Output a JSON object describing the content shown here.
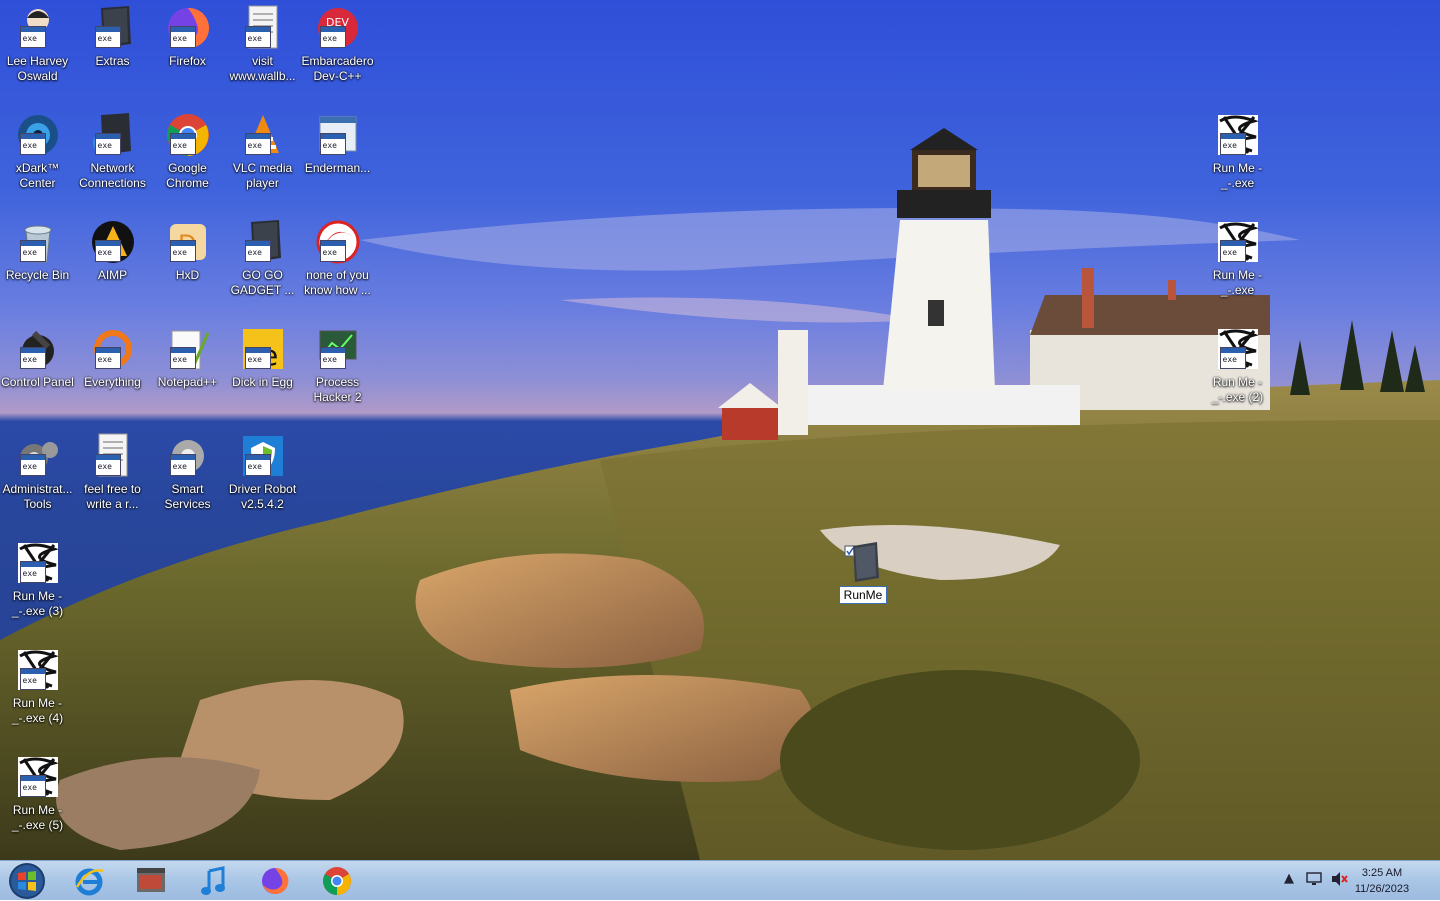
{
  "desktop_icons": [
    {
      "label": "Lee Harvey Oswald",
      "icon": "figure-icon"
    },
    {
      "label": "Extras",
      "icon": "box-icon"
    },
    {
      "label": "Firefox",
      "icon": "firefox-icon"
    },
    {
      "label": "visit www.wallb...",
      "icon": "document-icon"
    },
    {
      "label": "Embarcadero Dev-C++",
      "icon": "devcpp-icon"
    },
    {
      "label": "xDark™ Center",
      "icon": "disc-icon"
    },
    {
      "label": "Network Connections",
      "icon": "network-icon"
    },
    {
      "label": "Google Chrome",
      "icon": "chrome-icon"
    },
    {
      "label": "VLC media player",
      "icon": "vlc-icon"
    },
    {
      "label": "Enderman...",
      "icon": "window-icon"
    },
    {
      "label": "Recycle Bin",
      "icon": "recycle-bin-icon"
    },
    {
      "label": "AIMP",
      "icon": "aimp-icon"
    },
    {
      "label": "HxD",
      "icon": "hxd-icon"
    },
    {
      "label": "GO GO GADGET ...",
      "icon": "box-icon"
    },
    {
      "label": "none of you know how ...",
      "icon": "red-circle-icon"
    },
    {
      "label": "Control Panel",
      "icon": "control-panel-icon"
    },
    {
      "label": "Everything",
      "icon": "search-ring-icon"
    },
    {
      "label": "Notepad++",
      "icon": "notepad-icon"
    },
    {
      "label": "Dick in Egg",
      "icon": "egg-icon"
    },
    {
      "label": "Process Hacker 2",
      "icon": "monitor-icon"
    },
    {
      "label": "Administrat... Tools",
      "icon": "gears-icon"
    },
    {
      "label": "feel free to write a r...",
      "icon": "document-icon"
    },
    {
      "label": "Smart Services",
      "icon": "gear-icon"
    },
    {
      "label": "Driver Robot v2.5.4.2",
      "icon": "shield-icon"
    },
    {
      "label": "Run Me -_-.exe (3)",
      "icon": "scribble-icon"
    },
    {
      "label": "Run Me -_-.exe (4)",
      "icon": "scribble-icon"
    },
    {
      "label": "Run Me -_-.exe (5)",
      "icon": "scribble-icon"
    },
    {
      "label": "Run Me -_-.exe",
      "icon": "scribble-icon"
    },
    {
      "label": "Run Me -_-.exe",
      "icon": "scribble-icon"
    },
    {
      "label": "Run Me -_-.exe (2)",
      "icon": "scribble-icon"
    }
  ],
  "selected_icon": {
    "label": "RunMe",
    "icon": "file-icon"
  },
  "taskbar": {
    "pinned": [
      "windows-start-icon",
      "internet-explorer-icon",
      "film-icon",
      "music-note-icon",
      "firefox-icon",
      "chrome-icon"
    ],
    "clock_time": "3:25 AM",
    "clock_date": "11/26/2023",
    "tray_icons": [
      "show-hidden-icon",
      "network-tray-icon",
      "volume-muted-icon"
    ]
  },
  "colors": {
    "sky": "#3f63dc",
    "sea": "#28469b",
    "taskbar": "#a9c6e6"
  }
}
